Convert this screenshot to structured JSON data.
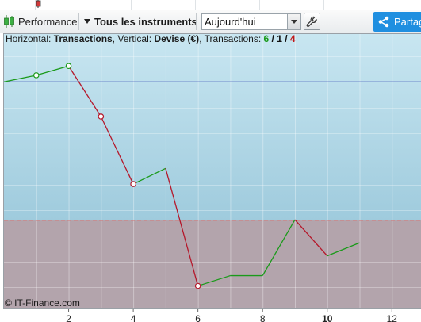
{
  "toolbar": {
    "performance_label": "Performance",
    "instruments_label": "Tous les instruments",
    "period_value": "Aujourd'hui",
    "share_label": "Partag"
  },
  "info": {
    "horizontal_prefix": "Horizontal: ",
    "horizontal_value": "Transactions",
    "vertical_prefix": ", Vertical: ",
    "vertical_value": "Devise (€)",
    "transactions_prefix": ", Transactions: ",
    "count_green": "6",
    "sep1": " / ",
    "count_black": "1",
    "sep2": " / ",
    "count_red": "4"
  },
  "copyright": "© IT-Finance.com",
  "colors": {
    "gain": "#1a9a1a",
    "loss": "#b5172a",
    "baseline": "#2233aa",
    "upper_bg": "#a9d3e3",
    "lower_bg": "#b3a4ac"
  },
  "chart_data": {
    "type": "line",
    "x": [
      0,
      1,
      2,
      3,
      4,
      5,
      6,
      7,
      8,
      9,
      10,
      11
    ],
    "y": [
      0.0,
      0.26,
      0.62,
      -1.35,
      -3.98,
      -3.37,
      -7.95,
      -7.55,
      -7.55,
      -5.37,
      -6.78,
      -6.27
    ],
    "segment_colors": [
      "gain",
      "gain",
      "loss",
      "loss",
      "gain",
      "loss",
      "gain",
      "gain",
      "gain",
      "loss",
      "gain"
    ],
    "markers": [
      {
        "x": 1,
        "y": 0.26,
        "color": "gain"
      },
      {
        "x": 2,
        "y": 0.62,
        "color": "gain"
      },
      {
        "x": 3,
        "y": -1.35,
        "color": "loss"
      },
      {
        "x": 4,
        "y": -3.98,
        "color": "loss"
      },
      {
        "x": 6,
        "y": -7.95,
        "color": "loss"
      }
    ],
    "baseline": 0,
    "threshold": -5.4,
    "xlim": [
      0,
      12.9
    ],
    "ylim": [
      -8.8,
      1.4
    ],
    "x_ticks": [
      "2",
      "4",
      "6",
      "8",
      "10",
      "12"
    ],
    "x_tick_values": [
      2,
      4,
      6,
      8,
      10,
      12
    ],
    "highlight_tick": "10",
    "grid": true
  }
}
